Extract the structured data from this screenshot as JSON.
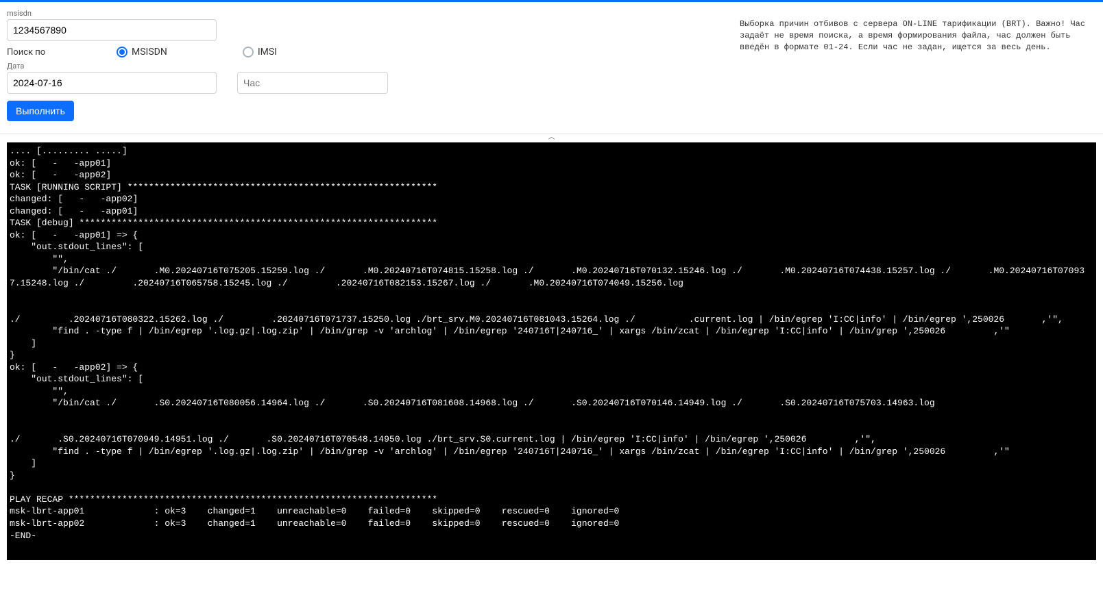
{
  "form": {
    "msisdn": {
      "label": "msisdn",
      "value": "1234567890"
    },
    "search_by": {
      "label": "Поиск по",
      "opt_msisdn": "MSISDN",
      "opt_imsi": "IMSI"
    },
    "date": {
      "label": "Дата",
      "value": "2024-07-16"
    },
    "hour": {
      "placeholder": "Час"
    },
    "submit": "Выполнить",
    "help_text": "Выборка причин отбивов с сервера ON-LINE тарификации (BRT). Важно! Час задаёт не время поиска, а время формирования файла, час должен быть введён в формате 01-24. Если час не задан, ищется за весь день."
  },
  "collapse_glyph": "︿",
  "console_text": ".... [......... .....]\nok: [   -   -app01]\nok: [   -   -app02]\nTASK [RUNNING SCRIPT] **********************************************************\nchanged: [   -   -app02]\nchanged: [   -   -app01]\nTASK [debug] *******************************************************************\nok: [   -   -app01] => {\n    \"out.stdout_lines\": [\n        \"\",\n        \"/bin/cat ./       .M0.20240716T075205.15259.log ./       .M0.20240716T074815.15258.log ./       .M0.20240716T070132.15246.log ./       .M0.20240716T074438.15257.log ./       .M0.20240716T070937.15248.log ./         .20240716T065758.15245.log ./         .20240716T082153.15267.log ./       .M0.20240716T074049.15256.log\n\n\n./         .20240716T080322.15262.log ./         .20240716T071737.15250.log ./brt_srv.M0.20240716T081043.15264.log ./          .current.log | /bin/egrep 'I:CC|info' | /bin/egrep ',250026       ,'\",\n        \"find . -type f | /bin/egrep '.log.gz|.log.zip' | /bin/grep -v 'archlog' | /bin/egrep '240716T|240716_' | xargs /bin/zcat | /bin/egrep 'I:CC|info' | /bin/grep ',250026         ,'\"\n    ]\n}\nok: [   -   -app02] => {\n    \"out.stdout_lines\": [\n        \"\",\n        \"/bin/cat ./       .S0.20240716T080056.14964.log ./       .S0.20240716T081608.14968.log ./       .S0.20240716T070146.14949.log ./       .S0.20240716T075703.14963.log\n\n\n./       .S0.20240716T070949.14951.log ./       .S0.20240716T070548.14950.log ./brt_srv.S0.current.log | /bin/egrep 'I:CC|info' | /bin/egrep ',250026         ,'\",\n        \"find . -type f | /bin/egrep '.log.gz|.log.zip' | /bin/grep -v 'archlog' | /bin/egrep '240716T|240716_' | xargs /bin/zcat | /bin/egrep 'I:CC|info' | /bin/grep ',250026         ,'\"\n    ]\n}\n\nPLAY RECAP *********************************************************************\nmsk-lbrt-app01             : ok=3    changed=1    unreachable=0    failed=0    skipped=0    rescued=0    ignored=0\nmsk-lbrt-app02             : ok=3    changed=1    unreachable=0    failed=0    skipped=0    rescued=0    ignored=0\n-END-"
}
